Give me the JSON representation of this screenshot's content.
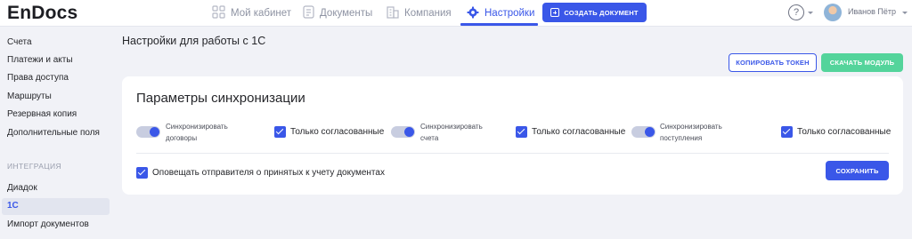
{
  "app": {
    "logo": "EnDocs"
  },
  "nav": {
    "items": [
      {
        "label": "Мой кабинет",
        "icon": "grid-icon"
      },
      {
        "label": "Документы",
        "icon": "document-icon"
      },
      {
        "label": "Компания",
        "icon": "building-icon"
      },
      {
        "label": "Настройки",
        "icon": "gear-icon",
        "active": true
      }
    ],
    "create_label": "СОЗДАТЬ ДОКУМЕНТ"
  },
  "header": {
    "help_glyph": "?",
    "user_name": "Иванов Пётр"
  },
  "sidebar": {
    "items": [
      "Счета",
      "Платежи и акты",
      "Права доступа",
      "Маршруты",
      "Резервная копия",
      "Дополнительные поля"
    ],
    "section_label": "ИНТЕГРАЦИЯ",
    "integration_items": [
      "Диадок",
      "1С",
      "Импорт документов"
    ],
    "active_item": "1С"
  },
  "main": {
    "title": "Настройки для работы с 1С",
    "copy_token_label": "КОПИРОВАТЬ ТОКЕН",
    "download_module_label": "СКАЧАТЬ МОДУЛЬ",
    "card": {
      "title": "Параметры синхронизации",
      "groups": [
        {
          "toggle_line1": "Синхронизировать",
          "toggle_line2": "договоры",
          "toggle_on": true,
          "check_label": "Только согласованные",
          "checked": true
        },
        {
          "toggle_line1": "Синхронизировать",
          "toggle_line2": "счета",
          "toggle_on": true,
          "check_label": "Только согласованные",
          "checked": true
        },
        {
          "toggle_line1": "Синхронизировать",
          "toggle_line2": "поступления",
          "toggle_on": true,
          "check_label": "Только согласованные",
          "checked": true
        }
      ],
      "notify_label": "Оповещать отправителя о принятых к учету документах",
      "notify_checked": true,
      "save_label": "СОХРАНИТЬ"
    }
  },
  "colors": {
    "accent": "#3a57e8",
    "green": "#54d49b",
    "background": "#f1f2f7"
  }
}
